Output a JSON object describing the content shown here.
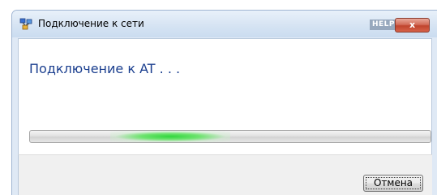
{
  "window": {
    "title": "Подключение к сети",
    "help_label": "HELP",
    "close_label": "x"
  },
  "content": {
    "main_instruction": "Подключение к AT . . .",
    "progress_state": "indeterminate",
    "progress_level": 0.35,
    "progress_color": "#2fd63c"
  },
  "footer": {
    "cancel_label": "Отмена"
  },
  "icons": {
    "title_icon": "network-connection-icon"
  },
  "colors": {
    "instruction_text": "#1b3f8f",
    "close_button": "#c0452e"
  }
}
